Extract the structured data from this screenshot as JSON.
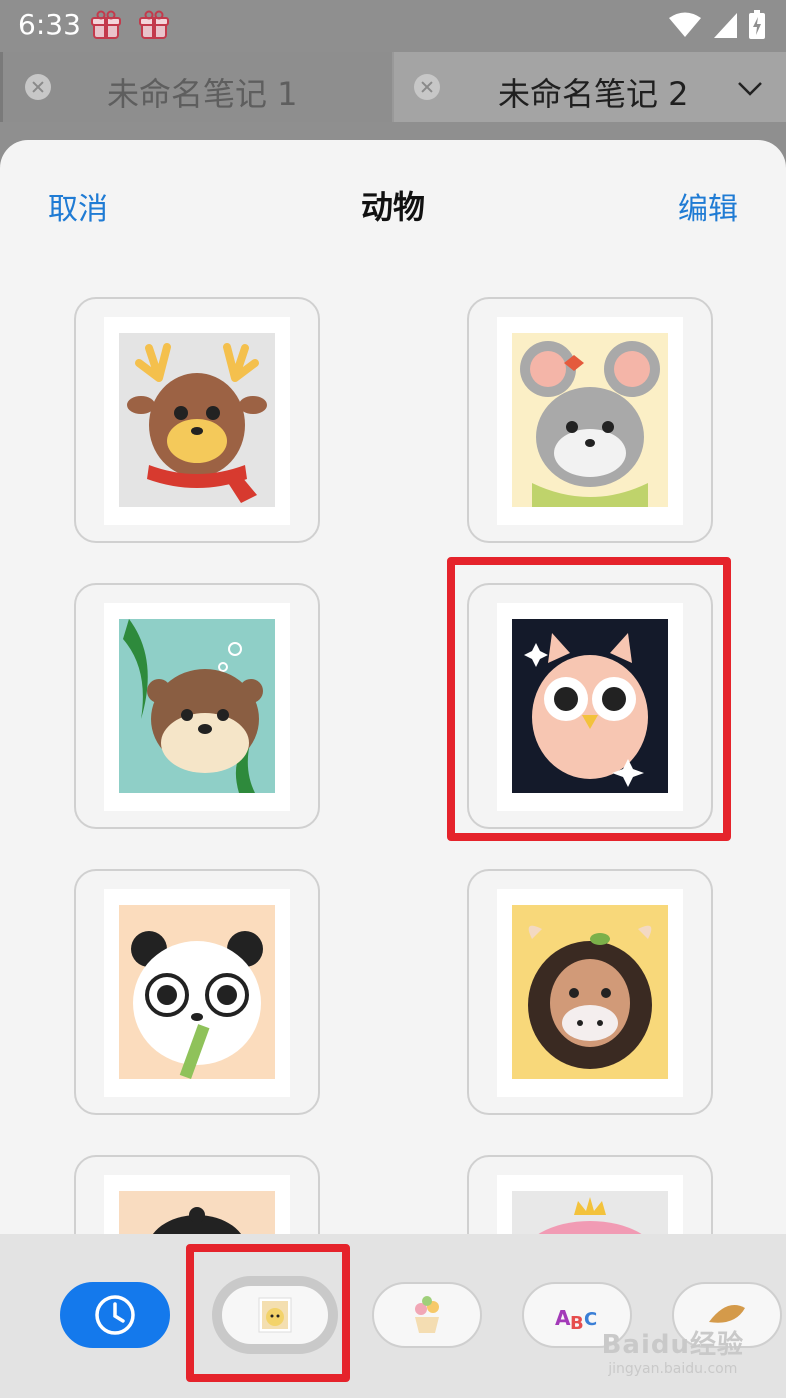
{
  "status_bar": {
    "time": "6:33",
    "icons": [
      "gift-icon",
      "gift-icon",
      "wifi-icon",
      "signal-icon",
      "battery-charging-icon"
    ]
  },
  "tabs": [
    {
      "label": "未命名笔记 1",
      "close_icon": "close-circle-icon",
      "active": false
    },
    {
      "label": "未命名笔记 2",
      "close_icon": "close-circle-icon",
      "active": true
    }
  ],
  "tab_menu_icon": "chevron-down-icon",
  "header": {
    "cancel_label": "取消",
    "title": "动物",
    "edit_label": "编辑"
  },
  "stickers": [
    {
      "animal": "deer",
      "bg": "#e4e4e4"
    },
    {
      "animal": "mouse",
      "bg": "#fbefc6"
    },
    {
      "animal": "otter",
      "bg": "#8fcfc7"
    },
    {
      "animal": "owl",
      "bg": "#141a2a",
      "highlighted": true
    },
    {
      "animal": "panda",
      "bg": "#fbdcbd"
    },
    {
      "animal": "cow",
      "bg": "#f8d87a"
    },
    {
      "animal": "hedgehog",
      "bg": "#f9dcc0"
    },
    {
      "animal": "pig",
      "bg": "#e8e8e8"
    }
  ],
  "bottom_tabs": [
    {
      "icon": "clock-icon",
      "name": "recent",
      "selected": false
    },
    {
      "icon": "cat-sticker-icon",
      "name": "animals",
      "selected": true
    },
    {
      "icon": "flower-pot-icon",
      "name": "plants",
      "selected": false
    },
    {
      "icon": "abc-letters-icon",
      "name": "letters",
      "selected": false
    },
    {
      "icon": "bread-icon",
      "name": "food",
      "selected": false
    }
  ],
  "watermark": {
    "brand": "Baidu经验",
    "url": "jingyan.baidu.com"
  },
  "accent_color": "#1f7bd4",
  "highlight_color": "#e5232b"
}
